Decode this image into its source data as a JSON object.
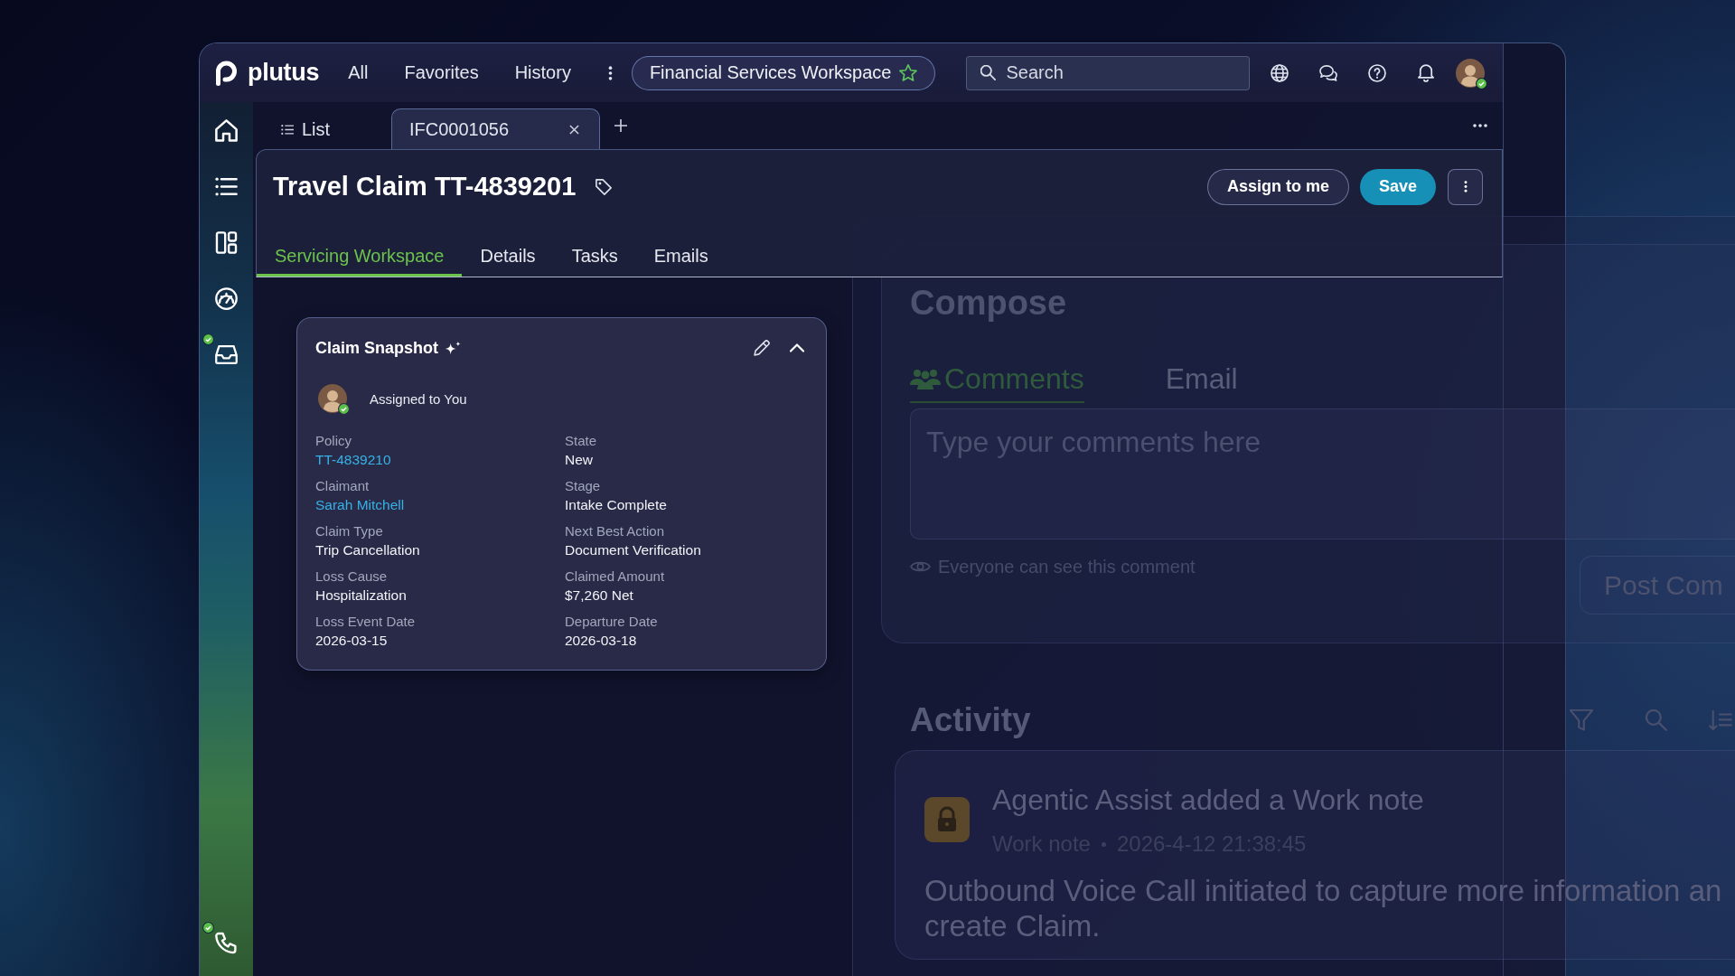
{
  "top_bar": {
    "brand": "plutus",
    "nav": [
      {
        "label": "All"
      },
      {
        "label": "Favorites"
      },
      {
        "label": "History"
      }
    ],
    "workspace": {
      "label": "Financial Services Workspace",
      "favorite": true
    },
    "search": {
      "placeholder": "Search"
    },
    "user": {
      "online": true
    }
  },
  "sidebar": {
    "items": [
      {
        "online": false
      },
      {
        "online": false
      },
      {
        "online": false
      },
      {
        "online": false
      },
      {
        "online": true
      },
      {
        "online": true
      }
    ]
  },
  "tabs": [
    {
      "label": "List",
      "kind": "list",
      "selected": false
    },
    {
      "label": "IFC0001056",
      "kind": "record",
      "selected": true
    }
  ],
  "record": {
    "title": "Travel Claim TT-4839201",
    "actions": [
      {
        "label": "Assign to me",
        "kind": "secondary"
      },
      {
        "label": "Save",
        "kind": "primary"
      }
    ],
    "tabs": [
      {
        "label": "Servicing Workspace",
        "selected": true
      },
      {
        "label": "Details",
        "selected": false
      },
      {
        "label": "Tasks",
        "selected": false
      },
      {
        "label": "Emails",
        "selected": false
      }
    ]
  },
  "claim_snapshot": {
    "title": "Claim Snapshot",
    "expanded": true,
    "assignee": {
      "label": "Assigned to You",
      "online": true
    },
    "fields": [
      {
        "label": "Policy",
        "value": "TT-4839210",
        "kind": "link"
      },
      {
        "label": "State",
        "value": "New",
        "kind": "text"
      },
      {
        "label": "Claimant",
        "value": "Sarah Mitchell",
        "kind": "link"
      },
      {
        "label": "Stage",
        "value": "Intake Complete",
        "kind": "text"
      },
      {
        "label": "Claim Type",
        "value": "Trip Cancellation",
        "kind": "text"
      },
      {
        "label": "Next Best Action",
        "value": "Document Verification",
        "kind": "text"
      },
      {
        "label": "Loss Cause",
        "value": "Hospitalization",
        "kind": "text"
      },
      {
        "label": "Claimed Amount",
        "value": "$7,260 Net",
        "kind": "text"
      },
      {
        "label": "Loss Event Date",
        "value": "2026-03-15",
        "kind": "text"
      },
      {
        "label": "Departure Date",
        "value": "2026-03-18",
        "kind": "text"
      }
    ]
  },
  "compose": {
    "title": "Compose",
    "tabs": [
      {
        "label": "Comments",
        "selected": true
      },
      {
        "label": "Email",
        "selected": false
      }
    ],
    "comment": {
      "placeholder": "Type your comments here"
    },
    "visibility_note": "Everyone can see this comment",
    "post_button": "Post Com"
  },
  "activity": {
    "title": "Activity",
    "entries": [
      {
        "title": "Agentic Assist added a Work note",
        "type": "Work note",
        "time": "2026-4-12 21:38:45",
        "body": "Outbound Voice Call initiated to capture more information an\ncreate Claim."
      }
    ]
  }
}
